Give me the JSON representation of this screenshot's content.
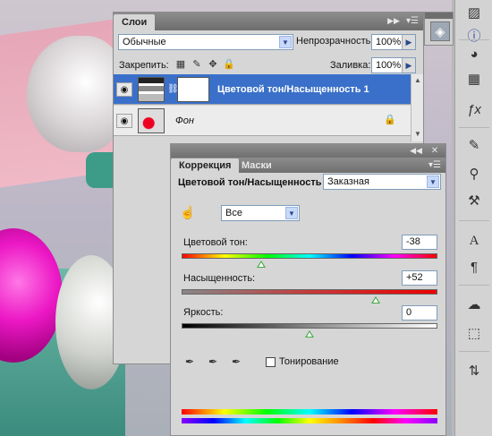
{
  "layers_panel": {
    "tab_label": "Слои",
    "blend_mode": "Обычные",
    "opacity_label": "Непрозрачность:",
    "opacity_value": "100%",
    "lock_label": "Закрепить:",
    "fill_label": "Заливка:",
    "fill_value": "100%",
    "layers": [
      {
        "name": "Цветовой тон/Насыщенность 1",
        "selected": true
      },
      {
        "name": "Фон",
        "selected": false
      }
    ]
  },
  "adjustments_panel": {
    "tabs": [
      "Коррекция",
      "Маски"
    ],
    "adjustment_name": "Цветовой тон/Насыщенность",
    "preset_value": "Заказная",
    "channel_value": "Все",
    "hue_label": "Цветовой тон:",
    "hue_value": "-38",
    "saturation_label": "Насыщенность:",
    "saturation_value": "+52",
    "lightness_label": "Яркость:",
    "lightness_value": "0",
    "colorize_label": "Тонирование",
    "hue_slider_fraction": 0.31,
    "saturation_slider_fraction": 0.76,
    "lightness_slider_fraction": 0.5
  },
  "dock": {
    "icons": [
      "histogram-icon",
      "info-icon",
      "color-icon",
      "swatches-icon",
      "styles-icon",
      "brushes-icon",
      "clone-source-icon",
      "tool-presets-icon",
      "character-icon",
      "paragraph-icon",
      "channels-icon",
      "paths-icon",
      "history-icon"
    ]
  },
  "colors": {
    "selected_layer": "#3a70c9",
    "panel_bg": "#d6d6d6",
    "accent_red": "#cc1122"
  }
}
